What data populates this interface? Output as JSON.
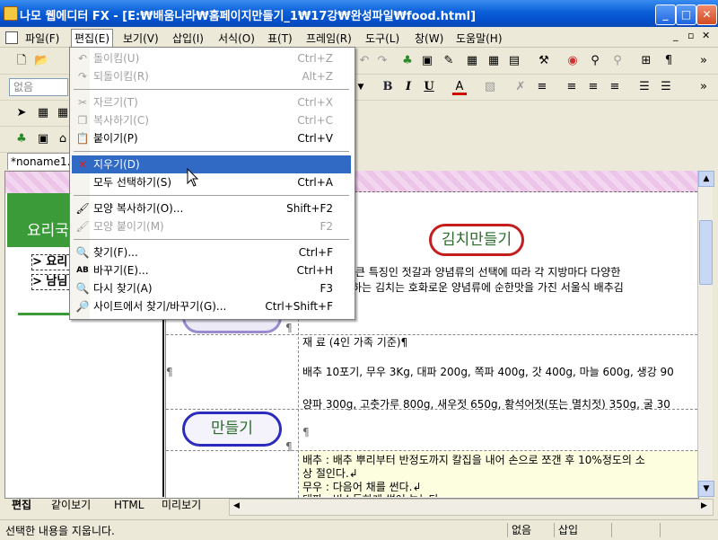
{
  "window": {
    "title": "나모 웹에디터 FX - [E:₩배움나라₩홈페이지만들기_1₩17강₩완성파일₩food.html]"
  },
  "window_controls": {
    "minimize": "_",
    "maximize": "□",
    "close": "✕"
  },
  "menubar": {
    "items": [
      "파일(F)",
      "편집(E)",
      "보기(V)",
      "삽입(I)",
      "서식(O)",
      "표(T)",
      "프레임(R)",
      "도구(L)",
      "창(W)",
      "도움말(H)"
    ],
    "active_index": 1,
    "right_controls": [
      "_",
      "▫",
      "✕"
    ]
  },
  "toolbar": {
    "style_select": "없음",
    "bold": "B",
    "italic": "I",
    "underline": "U",
    "text_color": "A",
    "more": "»"
  },
  "edit_menu": {
    "items": [
      {
        "label": "돌이킴(U)",
        "shortcut": "Ctrl+Z",
        "disabled": true,
        "icon": "undo-icon"
      },
      {
        "label": "되돌이킴(R)",
        "shortcut": "Alt+Z",
        "disabled": true,
        "icon": "redo-icon"
      },
      {
        "label": "자르기(T)",
        "shortcut": "Ctrl+X",
        "disabled": true,
        "icon": "scissors-icon"
      },
      {
        "label": "복사하기(C)",
        "shortcut": "Ctrl+C",
        "disabled": true,
        "icon": "copy-icon"
      },
      {
        "label": "붙이기(P)",
        "shortcut": "Ctrl+V",
        "disabled": false,
        "icon": "paste-icon"
      },
      {
        "label": "지우기(D)",
        "shortcut": "",
        "disabled": false,
        "icon": "delete-icon",
        "highlighted": true
      },
      {
        "label": "모두 선택하기(S)",
        "shortcut": "Ctrl+A",
        "disabled": false,
        "icon": ""
      },
      {
        "label": "모양 복사하기(O)...",
        "shortcut": "Shift+F2",
        "disabled": false,
        "icon": "format-copy-icon"
      },
      {
        "label": "모양 붙이기(M)",
        "shortcut": "F2",
        "disabled": true,
        "icon": "format-paste-icon"
      },
      {
        "label": "찾기(F)...",
        "shortcut": "Ctrl+F",
        "disabled": false,
        "icon": "find-icon"
      },
      {
        "label": "바꾸기(E)...",
        "shortcut": "Ctrl+H",
        "disabled": false,
        "icon": "replace-icon"
      },
      {
        "label": "다시 찾기(A)",
        "shortcut": "F3",
        "disabled": false,
        "icon": "find-again-icon"
      },
      {
        "label": "사이트에서 찾기/바꾸기(G)...",
        "shortcut": "Ctrl+Shift+F",
        "disabled": false,
        "icon": "site-find-icon"
      }
    ]
  },
  "document": {
    "tab": "*noname1.",
    "left": {
      "title": "요리국",
      "links": [
        "요리",
        "남님"
      ]
    },
    "right": {
      "heading": "김치만들기",
      "para_line1": "가장 큰 특징인 젓갈과 양념류의 선택에 따라 각 지방마다 다양한",
      "para_line2": "소개하는 김치는 호화로운 양념류에 순한맛을 가진 서울식 배추김",
      "materials_title": "재   료 (4인 가족 기준)¶",
      "ingredients_line1": "배추 10포기, 무우 3Kg, 대파 200g, 쪽파 400g, 갓 400g, 마늘 600g, 생강 90",
      "ingredients_line2": "양파 300g, 고춧가루 800g, 새우젓 650g, 황석어젓(또는 멸치젓) 350g, 굴 30",
      "section2": "만들기",
      "step1": "배추 : 배추 뿌리부터 반정도까지 칼집을 내어 손으로 쪼갠 후 10%정도의 소",
      "step2": "상 절인다.↲",
      "step3": "무우 : 다음어 채를 썬다.↲",
      "step4": "대파 : 비스듬하게 썰어 놓는다.",
      "pilcrow": "¶"
    }
  },
  "view_tabs": [
    "편집",
    "같이보기",
    "HTML",
    "미리보기"
  ],
  "status": {
    "message": "선택한 내용을 지웁니다.",
    "cell2": "없음",
    "cell3": "삽입"
  },
  "colors": {
    "titlebar": "#0a5fd8",
    "highlight": "#316ac5",
    "green": "#3a9b38",
    "pill_blue": "#2b2bbd",
    "pill_red": "#c41e1e"
  }
}
